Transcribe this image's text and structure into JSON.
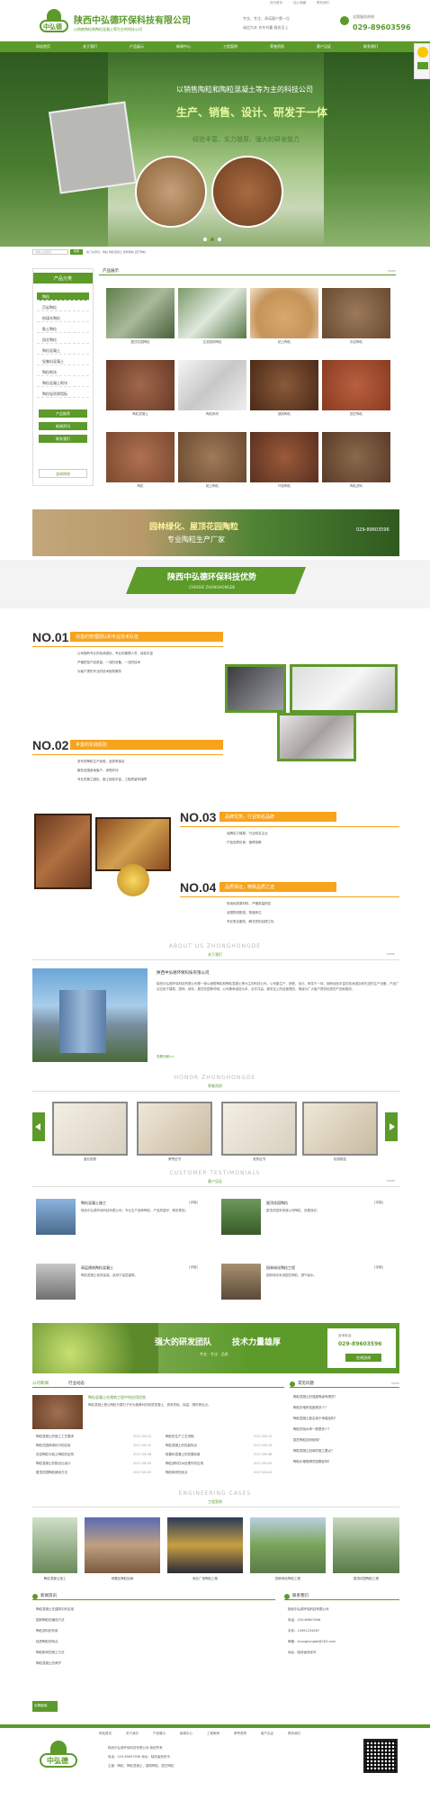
{
  "topbar": {
    "links": [
      "设为首页",
      "加入收藏",
      "联系我们"
    ]
  },
  "header": {
    "logo_text": "中弘德",
    "company_name": "陕西中弘德环保科技有限公司",
    "slogan": "以销售陶粒和陶粒混凝土等为主的科技公司",
    "contact_lines": [
      "专业、专注、承诺客户第一位",
      "诚信为本 合作共赢 服务至上"
    ],
    "hotline_label": "全国服务热线",
    "hotline": "029-89603596"
  },
  "nav": {
    "items": [
      "网站首页",
      "关于我们",
      "产品展示",
      "新闻中心",
      "工程案例",
      "荣誉资质",
      "客户见证",
      "联系我们"
    ]
  },
  "banner": {
    "line1": "以销售陶粒和陶粒混凝土等为主的科技公司",
    "line2": "生产、销售、设计、研发于一体",
    "line3": "经验丰富、实力雄厚、强大的研发能力"
  },
  "search": {
    "placeholder": "请输入关键词",
    "button": "搜索",
    "hot": "热门关键词：陶粒 陶粒混凝土 建筑陶粒 园艺陶粒"
  },
  "sidebar": {
    "title": "产品分类",
    "items": [
      "陶粒",
      "页岩陶粒",
      "粉煤灰陶粒",
      "黏土陶粒",
      "园艺陶粒",
      "陶粒混凝土",
      "轻集料混凝土",
      "陶粒砌块",
      "陶粒混凝土砌块",
      "陶粒轻质隔墙板"
    ],
    "buttons": [
      "产品推荐",
      "新闻资讯",
      "联系我们"
    ],
    "phone_label": "咨询热线"
  },
  "products": {
    "title": "产品展示",
    "more": "MORE",
    "items": [
      "屋顶花园陶粒",
      "生态园林陶粒",
      "粘土陶粒",
      "页岩陶粒",
      "陶粒混凝土",
      "陶粒砌块",
      "建筑陶粒",
      "园艺陶粒",
      "陶粒",
      "黏土陶粒",
      "环保陶粒",
      "陶粒滤料"
    ]
  },
  "ad_banner": {
    "line1": "园林绿化、屋顶花园陶粒",
    "line2": "专业陶粒生产厂家",
    "phone": "029-89603596"
  },
  "advantages": {
    "title": "陕西中弘德环保科技优势",
    "subtitle": "CHOOSE ZHONGHONGDE",
    "items": [
      {
        "no": "NO.01",
        "title": "完善的管理团队和专业技术队伍",
        "points": [
          "公司拥有专业的技术团队，专业的管理人员，经验丰富",
          "严格把控产品质量，一流的设备，一流的技术",
          "为客户提供专业的技术指导服务"
        ]
      },
      {
        "no": "NO.02",
        "title": "丰富的实践经验",
        "points": [
          "多年的陶粒生产经验，品质有保证",
          "服务全国各地客户，深受好评",
          "专业的施工团队，施工经验丰富，工程质量有保障"
        ]
      },
      {
        "no": "NO.03",
        "title": "品牌优势，行业知名品牌",
        "points": [
          "品牌实力雄厚，行业知名企业",
          "产品品质优良，值得信赖"
        ]
      },
      {
        "no": "NO.04",
        "title": "品质保证，精致品质之选",
        "points": [
          "采用优质原材料，严格质量把控",
          "全国物流配送，快速到达",
          "专业售后服务，解决您的后顾之忧"
        ]
      }
    ]
  },
  "about": {
    "title_en": "ABOUT US ZHONGHONGDE",
    "title_cn": "关于我们",
    "more": "MORE",
    "heading": "陕西中弘德环保科技有限公司",
    "text": "陕西中弘德环保科技有限公司是一家以销售陶粒和陶粒混凝土等为主的科技公司，公司集生产、销售、设计、研发于一体，拥有经验丰富的技术团队和先进的生产设备，产品广泛应用于建筑、园林、绿化、屋顶花园等领域。公司秉承诚信为本、合作共赢、服务至上的经营理念，竭诚为广大客户提供优质的产品和服务。",
    "more_link": "查看详细>>"
  },
  "honor": {
    "title_en": "HONOR ZHONGHONGDE",
    "title_cn": "荣誉资质",
    "items": [
      "营业执照",
      "荣誉证书",
      "资质证书",
      "检测报告"
    ]
  },
  "testimonials": {
    "title_en": "CUSTOMER TESTIMONIALS",
    "title_cn": "客户见证",
    "more": "MORE",
    "items": [
      {
        "title": "陶粒混凝土施工",
        "detail": "[详细]",
        "text": "陕西中弘德环保科技有限公司，专业生产各种陶粒，产品质量好，服务周到。"
      },
      {
        "title": "屋顶花园陶粒",
        "detail": "[详细]",
        "text": "屋顶花园采用我公司陶粒，效果良好。"
      },
      {
        "title": "高层建筑陶粒混凝土",
        "detail": "[详细]",
        "text": "陶粒混凝土轻质高强，适用于高层建筑。"
      },
      {
        "title": "园林绿化陶粒工程",
        "detail": "[详细]",
        "text": "园林绿化采用园艺陶粒，透气保水。"
      }
    ]
  },
  "team_banner": {
    "line1": "强大的研发团队",
    "line2": "技术力量雄厚",
    "sub": "专业 · 专注 · 品质",
    "phone_label": "咨询电话：",
    "phone": "029-89603596",
    "button": "在线咨询"
  },
  "news": {
    "tabs": [
      "公司新闻",
      "行业动态"
    ],
    "featured_title": "陶粒混凝土在建筑工程中的应用优势",
    "featured_text": "陶粒混凝土是以陶粒代替石子作为粗骨料的轻质混凝土，具有质轻、保温、隔热等优点。",
    "left": [
      "陶粒混凝土的施工工艺要求",
      "陶粒在园林绿化中的应用",
      "页岩陶粒与粘土陶粒的区别",
      "陶粒混凝土的配合比设计",
      "屋顶花园陶粒铺设方法"
    ],
    "right": [
      "陶粒的生产工艺流程",
      "陶粒混凝土的性能特点",
      "轻集料混凝土的发展前景",
      "陶粒滤料在水处理中的应用",
      "陶粒砌块的优点"
    ],
    "dates": [
      "2017-06-12",
      "2017-06-10",
      "2017-06-08",
      "2017-06-05",
      "2017-06-02"
    ]
  },
  "faq": {
    "title": "常见问题",
    "more": "MORE",
    "items": [
      "陶粒混凝土的强度等级有哪些？",
      "陶粒的堆积密度是多少？",
      "陶粒混凝土能否用于承重结构？",
      "陶粒的吸水率一般是多少？",
      "园艺陶粒如何使用？",
      "陶粒混凝土回填的施工要点？",
      "陶粒价格受哪些因素影响？"
    ]
  },
  "cases": {
    "title_en": "ENGINEERING CASES",
    "title_cn": "工程案例",
    "items": [
      "陶粒混凝土施工",
      "别墅区陶粒回填",
      "商业广场陶粒工程",
      "园林绿化陶粒工程",
      "屋顶花园陶粒工程"
    ]
  },
  "bottom_news": {
    "left_title": "新闻资讯",
    "right_title": "联系我们",
    "left": [
      "陶粒混凝土在建筑中的应用",
      "园林陶粒的铺设方法",
      "陶粒滤料的作用",
      "轻质陶粒的特点",
      "陶粒砌块的施工方法",
      "陶粒混凝土的养护"
    ],
    "right_lines": [
      "陕西中弘德环保科技有限公司",
      "电话：029-89603596",
      "手机：13991234567",
      "邮箱：zhonghongde@163.com",
      "地址：陕西省西安市"
    ],
    "link_label": "友情链接："
  },
  "footer": {
    "links": [
      "网站首页",
      "关于我们",
      "产品展示",
      "新闻中心",
      "工程案例",
      "荣誉资质",
      "客户见证",
      "联系我们"
    ],
    "lines": [
      "陕西中弘德环保科技有限公司 版权所有",
      "电话：029-89603596 地址：陕西省西安市",
      "主营：陶粒，陶粒混凝土，建筑陶粒，园艺陶粒"
    ],
    "logo_text": "中弘德"
  },
  "colors": {
    "brand": "#5c9a2a",
    "accent": "#f7a31c",
    "text": "#555555"
  }
}
